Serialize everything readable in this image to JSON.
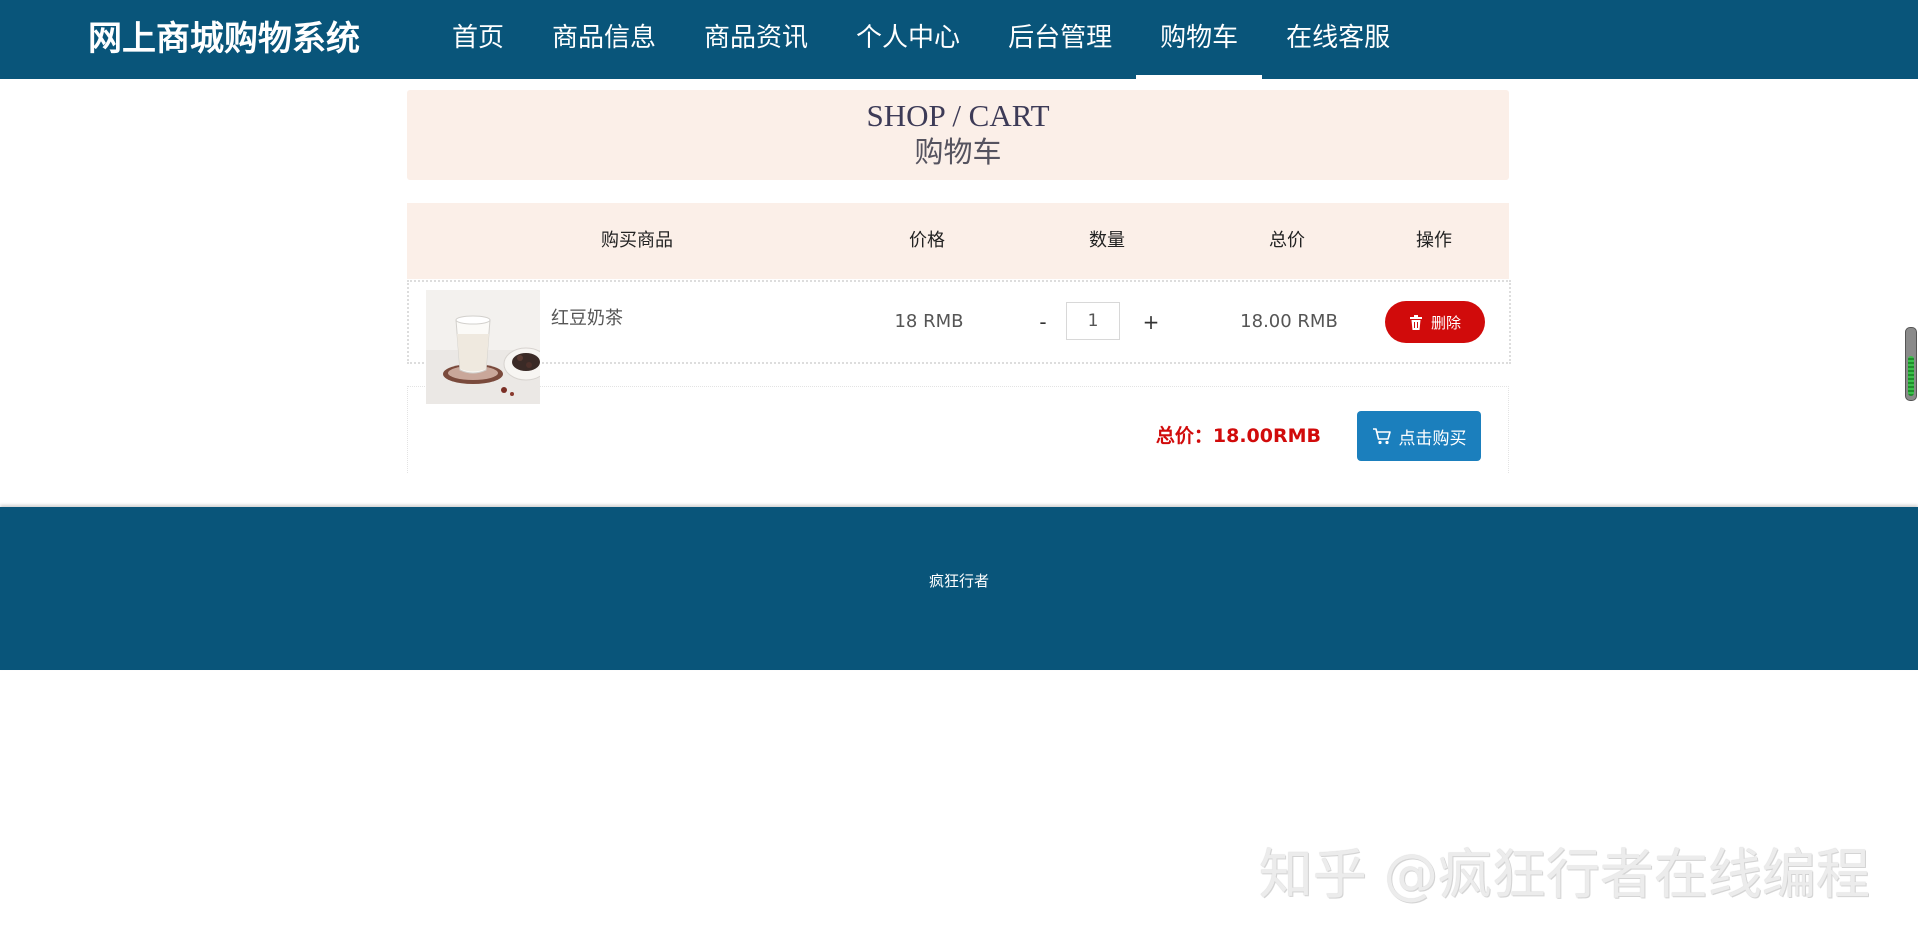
{
  "header": {
    "brand": "网上商城购物系统",
    "nav": [
      {
        "label": "首页",
        "active": false
      },
      {
        "label": "商品信息",
        "active": false
      },
      {
        "label": "商品资讯",
        "active": false
      },
      {
        "label": "个人中心",
        "active": false
      },
      {
        "label": "后台管理",
        "active": false
      },
      {
        "label": "购物车",
        "active": true
      },
      {
        "label": "在线客服",
        "active": false
      }
    ]
  },
  "banner": {
    "title_en": "SHOP / CART",
    "title_cn": "购物车"
  },
  "cart": {
    "columns": [
      "购买商品",
      "价格",
      "数量",
      "总价",
      "操作"
    ],
    "items": [
      {
        "name": "红豆奶茶",
        "price": "18 RMB",
        "qty_minus": "-",
        "quantity": "1",
        "qty_plus": "+",
        "subtotal": "18.00 RMB",
        "delete_label": "删除",
        "delete_icon": "trash-icon",
        "thumbnail": "milk-tea-glass-image"
      }
    ],
    "total_text": "总价：18.00RMB",
    "buy_label": "点击购买",
    "buy_icon": "cart-icon"
  },
  "footer": {
    "text": "疯狂行者"
  },
  "watermark": "知乎 @疯狂行者在线编程",
  "colors": {
    "primary": "#09557a",
    "banner_bg": "#fbefe8",
    "danger": "#d10b0b",
    "buy_button": "#1b7fbd"
  }
}
